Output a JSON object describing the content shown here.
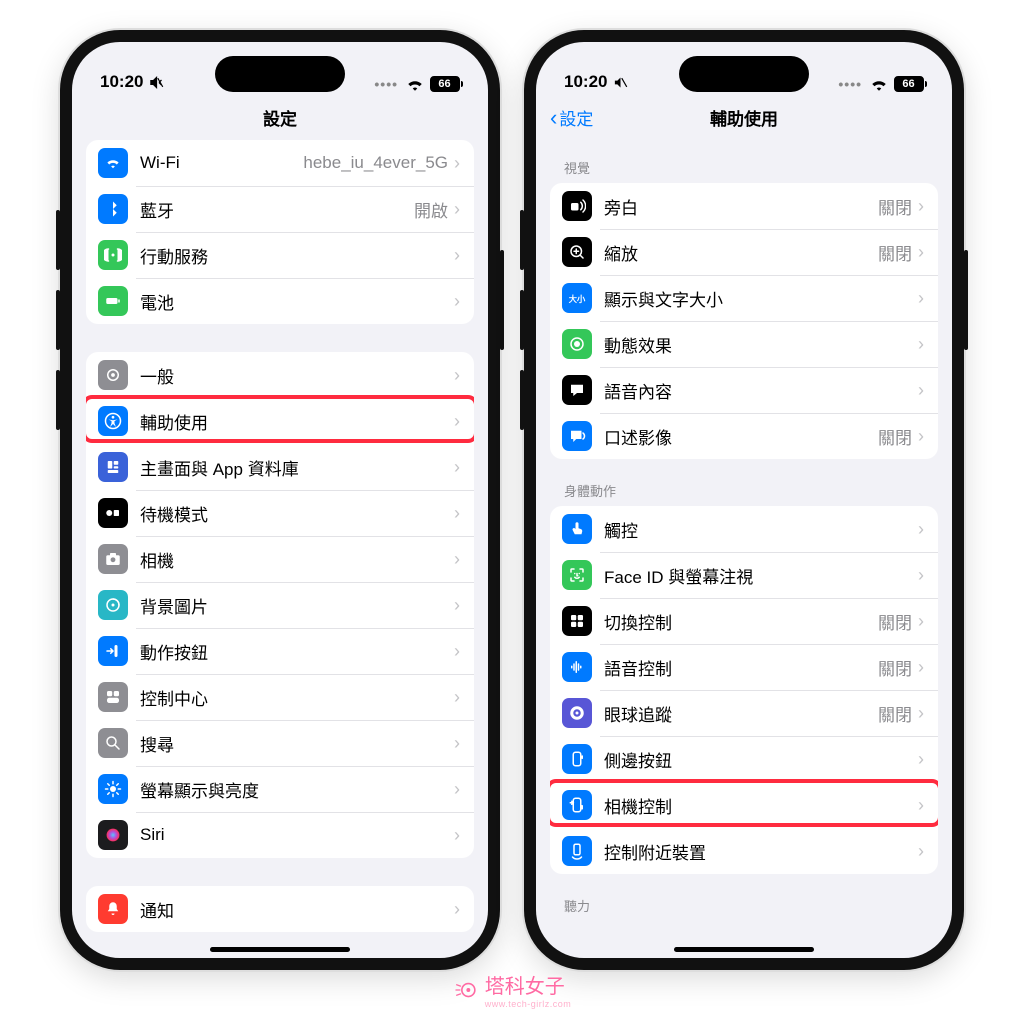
{
  "status": {
    "time": "10:20",
    "battery": "66"
  },
  "left": {
    "title": "設定",
    "g1": [
      {
        "icon": "wifi",
        "bg": "#007aff",
        "label": "Wi-Fi",
        "value": "hebe_iu_4ever_5G"
      },
      {
        "icon": "bluetooth",
        "bg": "#007aff",
        "label": "藍牙",
        "value": "開啟"
      },
      {
        "icon": "cell",
        "bg": "#34c759",
        "label": "行動服務",
        "value": ""
      },
      {
        "icon": "battery",
        "bg": "#34c759",
        "label": "電池",
        "value": ""
      }
    ],
    "g2": [
      {
        "icon": "gear",
        "bg": "#8e8e93",
        "label": "一般"
      },
      {
        "icon": "accessibility",
        "bg": "#007aff",
        "label": "輔助使用",
        "hl": true
      },
      {
        "icon": "apps",
        "bg": "#3a62d9",
        "label": "主畫面與 App 資料庫"
      },
      {
        "icon": "standby",
        "bg": "#000",
        "label": "待機模式"
      },
      {
        "icon": "camera",
        "bg": "#8e8e93",
        "label": "相機"
      },
      {
        "icon": "wallpaper",
        "bg": "#28b7c6",
        "label": "背景圖片"
      },
      {
        "icon": "action",
        "bg": "#007aff",
        "label": "動作按鈕"
      },
      {
        "icon": "control",
        "bg": "#8e8e93",
        "label": "控制中心"
      },
      {
        "icon": "search",
        "bg": "#8e8e93",
        "label": "搜尋"
      },
      {
        "icon": "display",
        "bg": "#007aff",
        "label": "螢幕顯示與亮度"
      },
      {
        "icon": "siri",
        "bg": "grad",
        "label": "Siri"
      }
    ],
    "g3": [
      {
        "icon": "bell",
        "bg": "#ff3b30",
        "label": "通知"
      }
    ]
  },
  "right": {
    "back": "設定",
    "title": "輔助使用",
    "h1": "視覺",
    "g1": [
      {
        "icon": "voiceover",
        "bg": "#000",
        "label": "旁白",
        "value": "關閉"
      },
      {
        "icon": "zoom",
        "bg": "#000",
        "label": "縮放",
        "value": "關閉"
      },
      {
        "icon": "textsize",
        "bg": "#007aff",
        "label": "顯示與文字大小",
        "value": ""
      },
      {
        "icon": "motion",
        "bg": "#34c759",
        "label": "動態效果",
        "value": ""
      },
      {
        "icon": "speech",
        "bg": "#000",
        "label": "語音內容",
        "value": ""
      },
      {
        "icon": "audiodesc",
        "bg": "#007aff",
        "label": "口述影像",
        "value": "關閉"
      }
    ],
    "h2": "身體動作",
    "g2": [
      {
        "icon": "touch",
        "bg": "#007aff",
        "label": "觸控",
        "value": ""
      },
      {
        "icon": "faceid",
        "bg": "#34c759",
        "label": "Face ID 與螢幕注視",
        "value": ""
      },
      {
        "icon": "switch",
        "bg": "#000",
        "label": "切換控制",
        "value": "關閉"
      },
      {
        "icon": "voicectrl",
        "bg": "#007aff",
        "label": "語音控制",
        "value": "關閉"
      },
      {
        "icon": "eyetrack",
        "bg": "#5856d6",
        "label": "眼球追蹤",
        "value": "關閉"
      },
      {
        "icon": "sidebutton",
        "bg": "#007aff",
        "label": "側邊按鈕",
        "value": ""
      },
      {
        "icon": "camcontrol",
        "bg": "#007aff",
        "label": "相機控制",
        "value": "",
        "hl": true
      },
      {
        "icon": "nearby",
        "bg": "#007aff",
        "label": "控制附近裝置",
        "value": ""
      }
    ],
    "h3": "聽力"
  },
  "watermark": "塔科女子",
  "watermark_url": "www.tech-girlz.com"
}
